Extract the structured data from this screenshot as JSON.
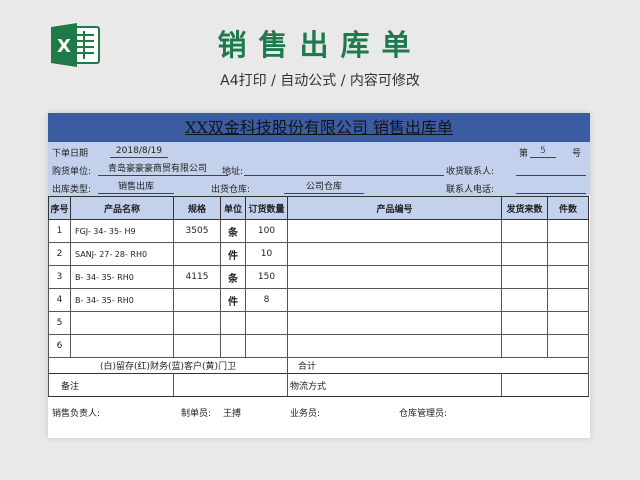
{
  "banner": {
    "title": "销售出库单",
    "subtitle": "A4打印 / 自动公式 / 内容可修改"
  },
  "colors": {
    "accent": "#1c7a4e",
    "header_bar": "#3b5ca0",
    "info_bg": "#c3d1ec"
  },
  "sheet": {
    "company_title": "XX双金科技股份有限公司  销售出库单",
    "info": {
      "date_label": "下单日期",
      "date_value": "2018/8/19",
      "no_label_pre": "第",
      "no_value": "5",
      "no_label_post": "号",
      "buyer_label": "购货单位:",
      "buyer_value": "青岛豪豪豪商贸有限公司",
      "address_label": "地址:",
      "receiver_label": "收货联系人:",
      "type_label": "出库类型:",
      "type_value": "销售出库",
      "warehouse_label": "出货仓库:",
      "warehouse_value": "公司仓库",
      "phone_label": "联系人电话:"
    },
    "columns": [
      "序号",
      "产品名称",
      "规格",
      "单位",
      "订货数量",
      "产品编号",
      "发货来数",
      "件数"
    ],
    "rows": [
      {
        "no": "1",
        "name": "FGJ- 34- 35- H9",
        "spec": "3505",
        "unit": "条",
        "qty": "100",
        "code": "",
        "sent": "",
        "pieces": ""
      },
      {
        "no": "2",
        "name": "SANJ- 27- 28- RH0",
        "spec": "",
        "unit": "件",
        "qty": "10",
        "code": "",
        "sent": "",
        "pieces": ""
      },
      {
        "no": "3",
        "name": "B- 34- 35- RH0",
        "spec": "4115",
        "unit": "条",
        "qty": "150",
        "code": "",
        "sent": "",
        "pieces": ""
      },
      {
        "no": "4",
        "name": "B- 34- 35- RH0",
        "spec": "",
        "unit": "件",
        "qty": "8",
        "code": "",
        "sent": "",
        "pieces": ""
      },
      {
        "no": "5",
        "name": "",
        "spec": "",
        "unit": "",
        "qty": "",
        "code": "",
        "sent": "",
        "pieces": ""
      },
      {
        "no": "6",
        "name": "",
        "spec": "",
        "unit": "",
        "qty": "",
        "code": "",
        "sent": "",
        "pieces": ""
      }
    ],
    "copies_text": "(白)留存(红)财务(蓝)客户(黄)门卫",
    "total_label": "合计",
    "remark_label": "备注",
    "logistics_label": "物流方式",
    "footer": {
      "sales_label": "销售负责人:",
      "maker_label": "制单员:",
      "maker_value": "王搏",
      "clerk_label": "业务员:",
      "warehouse_mgr_label": "仓库管理员:"
    }
  }
}
